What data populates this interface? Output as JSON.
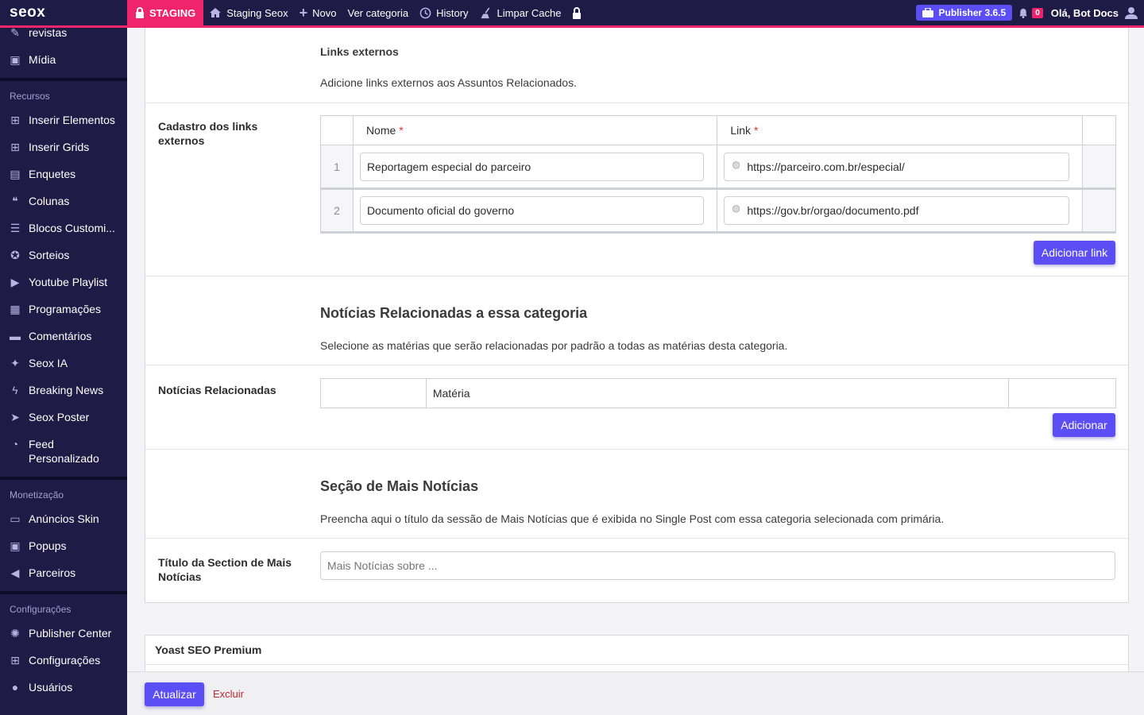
{
  "adminbar": {
    "logo": "seox",
    "staging": "STAGING",
    "site": "Staging Seox",
    "new": "Novo",
    "view_category": "Ver categoria",
    "history": "History",
    "clear_cache": "Limpar Cache",
    "publisher": "Publisher 3.6.5",
    "notifications": "0",
    "greeting": "Olá, Bot Docs"
  },
  "sidebar": {
    "top_items": [
      {
        "label": "revistas",
        "icon": "edit-icon"
      },
      {
        "label": "Mídia",
        "icon": "media-icon"
      }
    ],
    "sections": [
      {
        "heading": "Recursos",
        "items": [
          "Inserir Elementos",
          "Inserir Grids",
          "Enquetes",
          "Colunas",
          "Blocos Customi...",
          "Sorteios",
          "Youtube Playlist",
          "Programações",
          "Comentários",
          "Seox IA",
          "Breaking News",
          "Seox Poster",
          "Feed Personalizado"
        ]
      },
      {
        "heading": "Monetização",
        "items": [
          "Anúncios Skin",
          "Popups",
          "Parceiros"
        ]
      },
      {
        "heading": "Configurações",
        "items": [
          "Publisher Center",
          "Configurações",
          "Usuários"
        ]
      }
    ]
  },
  "links_section": {
    "title": "Links externos",
    "description": "Adicione links externos aos Assuntos Relacionados.",
    "field_label": "Cadastro dos links externos",
    "col_name": "Nome",
    "col_link": "Link",
    "required_mark": "*",
    "rows": [
      {
        "index": "1",
        "name": "Reportagem especial do parceiro",
        "link": "https://parceiro.com.br/especial/"
      },
      {
        "index": "2",
        "name": "Documento oficial do governo",
        "link": "https://gov.br/orgao/documento.pdf"
      }
    ],
    "add_button": "Adicionar link"
  },
  "related_section": {
    "title": "Notícias Relacionadas a essa categoria",
    "description": "Selecione as matérias que serão relacionadas por padrão a todas as matérias desta categoria.",
    "field_label": "Notícias Relacionadas",
    "col_materia": "Matéria",
    "add_button": "Adicionar"
  },
  "more_section": {
    "title": "Seção de Mais Notícias",
    "description": "Preencha aqui o título da sessão de Mais Notícias que é exibida no Single Post com essa categoria selecionada com primária.",
    "field_label": "Título da Section de Mais Notícias",
    "placeholder": "Mais Notícias sobre ..."
  },
  "yoast": {
    "title": "Yoast SEO Premium"
  },
  "footer": {
    "update": "Atualizar",
    "delete": "Excluir"
  }
}
